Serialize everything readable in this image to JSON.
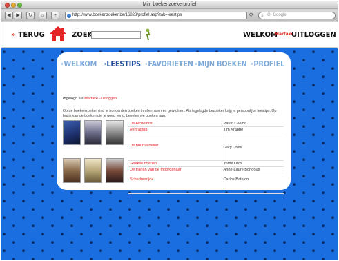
{
  "window": {
    "title": "Mijn boekenzoekerprofiel"
  },
  "toolbar": {
    "back_icon": "back-arrow-icon",
    "forward_icon": "forward-arrow-icon",
    "url": "http://www.boekenzoeker.be/16828/profiel.asp?tab=leestips",
    "search_placeholder": "Q- Google"
  },
  "header": {
    "back_label": "TERUG",
    "search_label": "ZOEK",
    "search_value": "",
    "welcome_label": "WELKOM",
    "user_name": "Marfake",
    "logout_label": "UITLOGGEN"
  },
  "tabs": [
    {
      "label": "WELKOM"
    },
    {
      "label": "LEESTIPS"
    },
    {
      "label": "FAVORIETEN"
    },
    {
      "label": "MIJN BOEKEN"
    },
    {
      "label": "PROFIEL"
    }
  ],
  "active_tab": "LEESTIPS",
  "content": {
    "login_prefix": "Ingelogd als",
    "login_user": "Marfake - uitloggen",
    "intro": "Op de boekenzoeker vind je honderden boeken in alle maten en gewichten. Als ingelogde bezoeker krijg je persoonlijke leestips. Op basis van de boeken die je goed vond, bevelen we boeken aan:"
  },
  "books": [
    {
      "title": "De Alchemist",
      "author": "Paulo Coelho"
    },
    {
      "title": "Vertraging",
      "author": "Tim Krabbé"
    },
    {
      "title": "De buurtverteller",
      "author": "Gary Crew"
    },
    {
      "title": "Griekse mythen",
      "author": "Imme Dros"
    },
    {
      "title": "De tranen van de moordenaar",
      "author": "Anne-Laure Bondoux"
    },
    {
      "title": "Schaduwzijde",
      "author": "Carlos Batelon"
    }
  ],
  "colors": {
    "background_blue": "#1a6ee0",
    "tab_active": "#1f4f9c",
    "tab_inactive": "#7fa9d9",
    "link_red": "#e52525"
  }
}
